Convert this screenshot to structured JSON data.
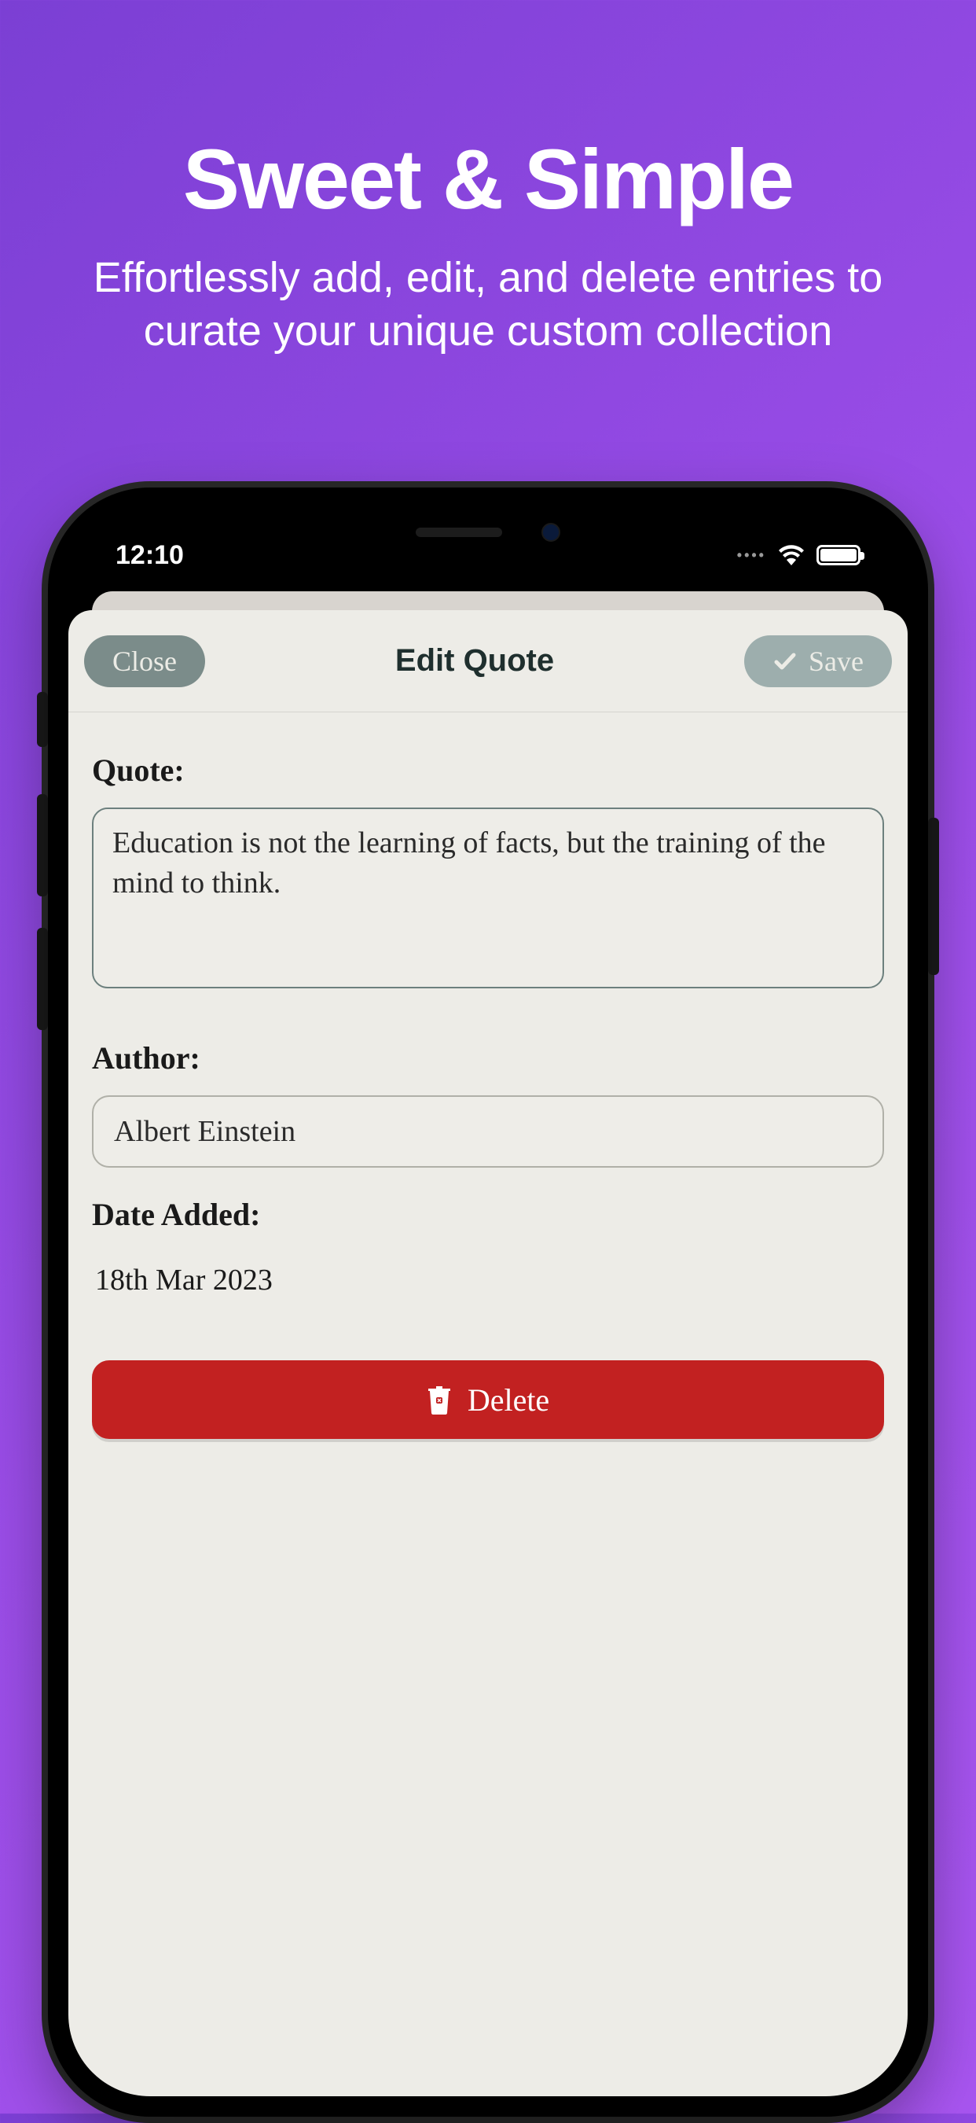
{
  "promo": {
    "title": "Sweet & Simple",
    "subtitle": "Effortlessly add, edit, and delete entries to curate your unique custom collection"
  },
  "status": {
    "time": "12:10"
  },
  "sheet": {
    "close_label": "Close",
    "title": "Edit Quote",
    "save_label": "Save"
  },
  "form": {
    "quote_label": "Quote:",
    "quote_value": "Education is not the learning of facts, but the training of the mind to think.",
    "author_label": "Author:",
    "author_value": "Albert Einstein",
    "date_label": "Date Added:",
    "date_value": "18th Mar 2023",
    "delete_label": "Delete"
  }
}
